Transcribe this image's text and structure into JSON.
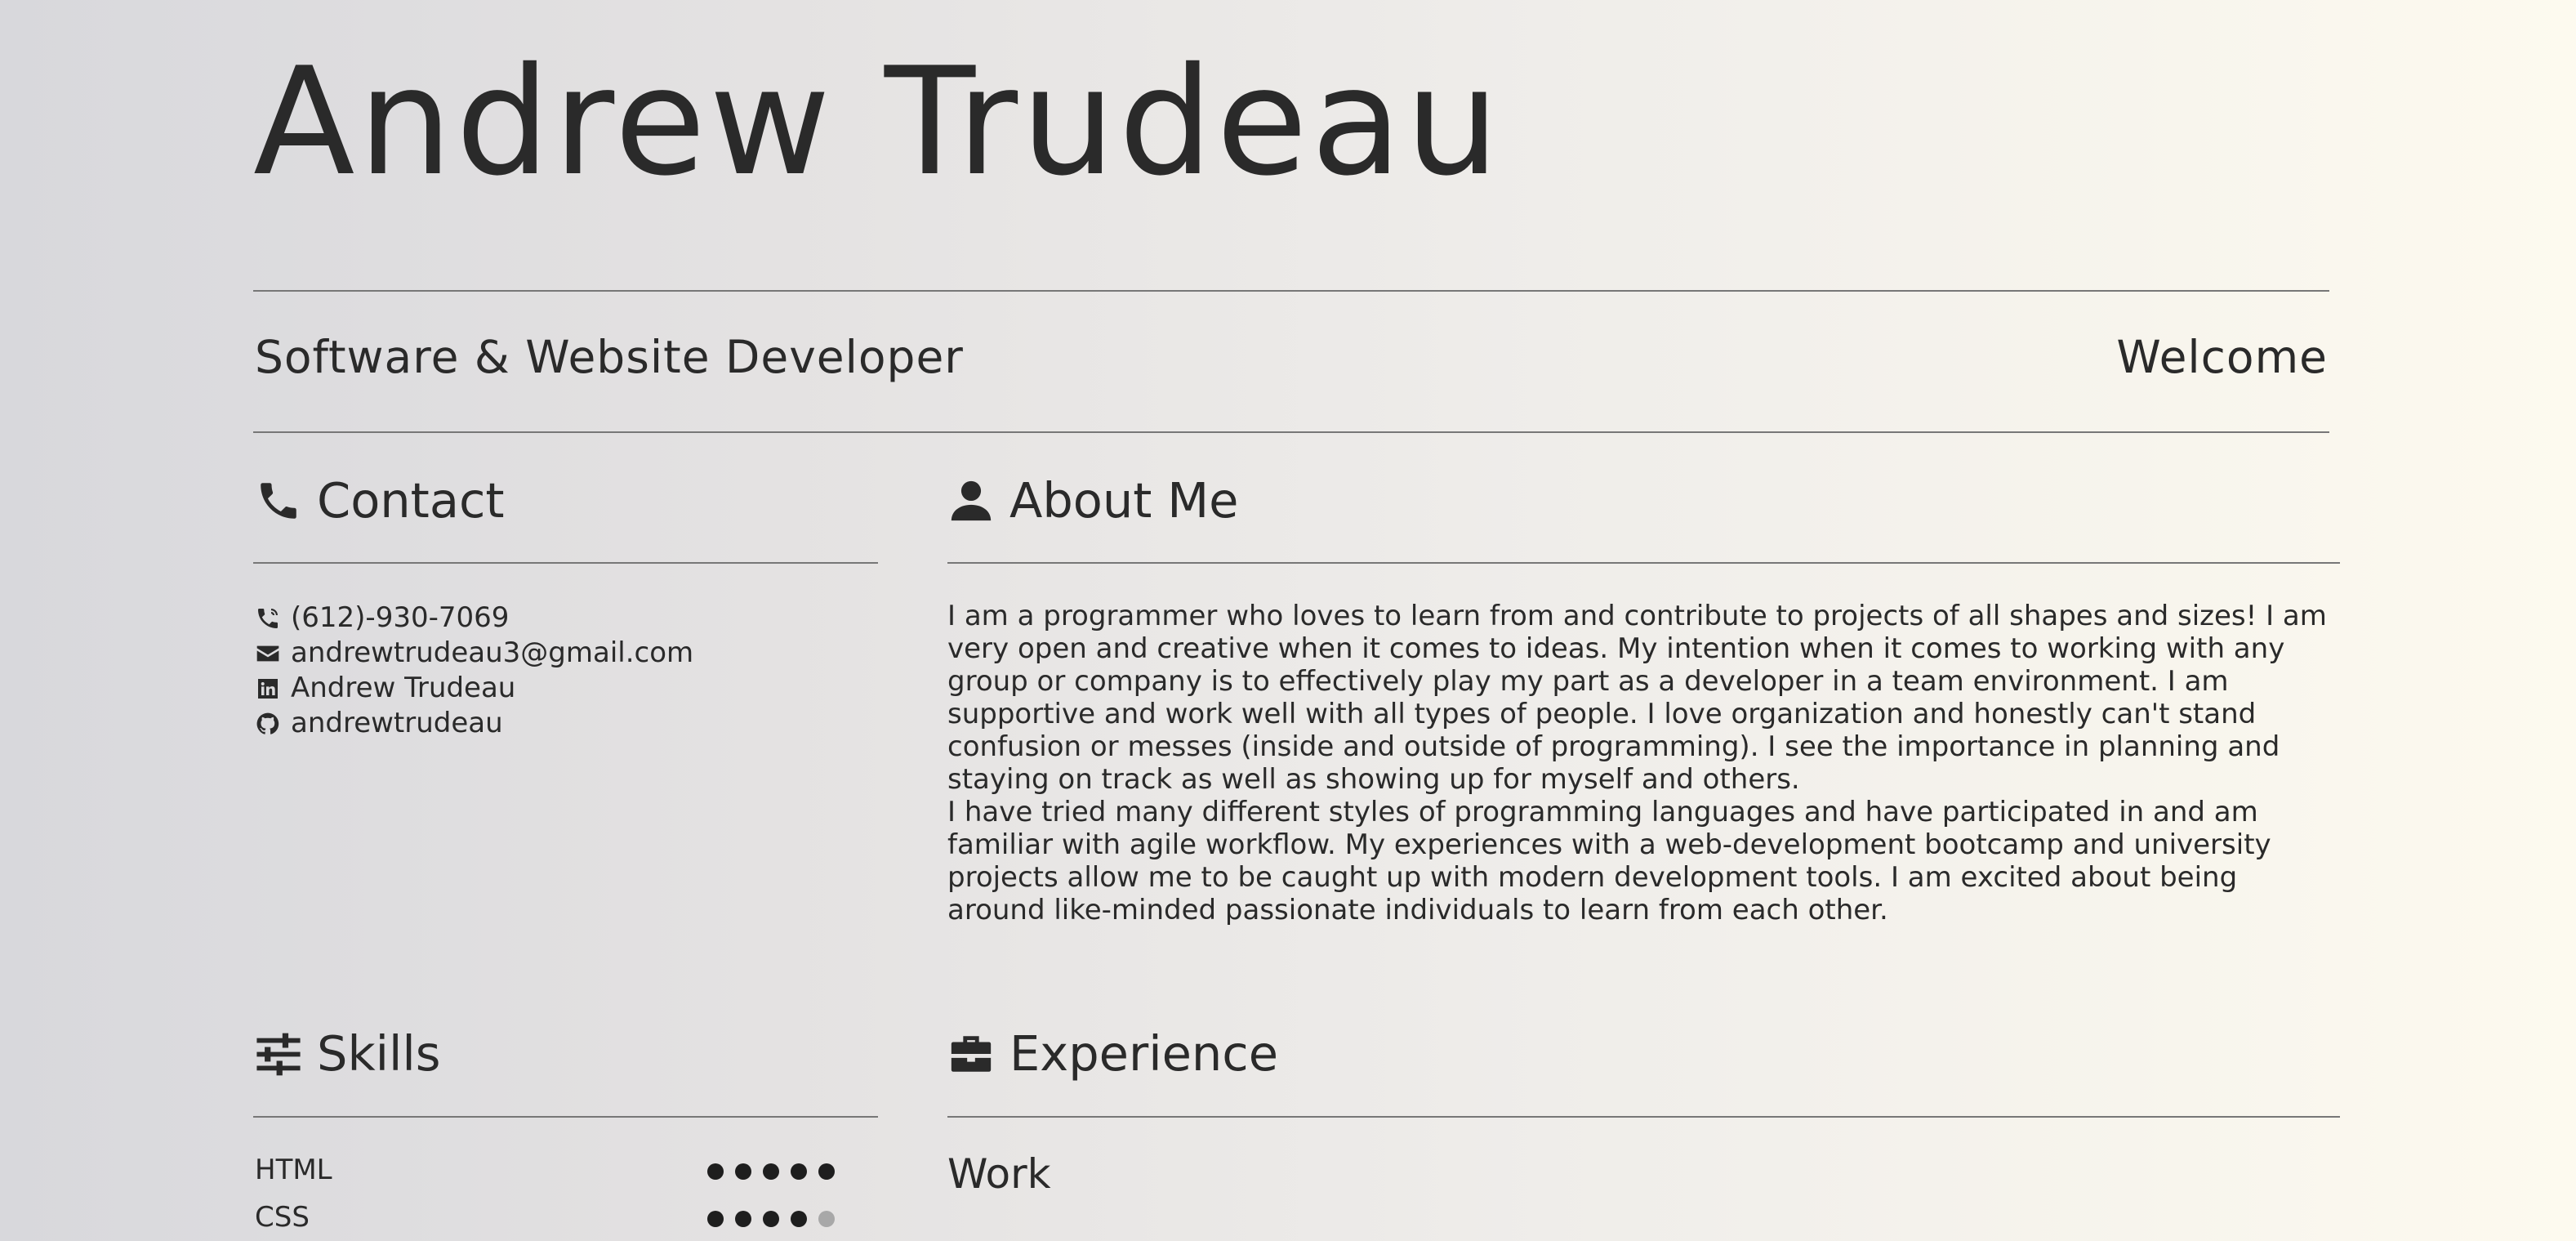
{
  "header": {
    "name": "Andrew Trudeau",
    "subtitle": "Software & Website Developer",
    "nav_welcome": "Welcome"
  },
  "contact": {
    "title": "Contact",
    "title_icon": "phone-icon",
    "items": [
      {
        "icon": "phone-ring-icon",
        "text": "(612)-930-7069"
      },
      {
        "icon": "envelope-icon",
        "text": "andrewtrudeau3@gmail.com"
      },
      {
        "icon": "linkedin-icon",
        "text": "Andrew Trudeau"
      },
      {
        "icon": "github-icon",
        "text": "andrewtrudeau"
      }
    ]
  },
  "about": {
    "title": "About Me",
    "title_icon": "user-icon",
    "paragraphs": [
      "I am a programmer who loves to learn from and contribute to projects of all shapes and sizes! I am very open and creative when it comes to ideas. My intention when it comes to working with any group or company is to effectively play my part as a developer in a team environment. I am supportive and work well with all types of people. I love organization and honestly can't stand confusion or messes (inside and outside of programming). I see the importance in planning and staying on track as well as showing up for myself and others.",
      "I have tried many different styles of programming languages and have participated in and am familiar with agile workflow. My experiences with a web-development bootcamp and university projects allow me to be caught up with modern development tools. I am excited about being around like-minded passionate individuals to learn from each other."
    ]
  },
  "skills": {
    "title": "Skills",
    "title_icon": "sliders-icon",
    "items": [
      {
        "label": "HTML",
        "level": 5,
        "max": 5
      },
      {
        "label": "CSS",
        "level": 4,
        "max": 5
      }
    ]
  },
  "experience": {
    "title": "Experience",
    "title_icon": "briefcase-icon",
    "work_label": "Work"
  },
  "colors": {
    "text": "#2a2a2a",
    "rule": "#777777",
    "dot_on": "#1e1e1e",
    "dot_off": "#a8a8a8"
  }
}
